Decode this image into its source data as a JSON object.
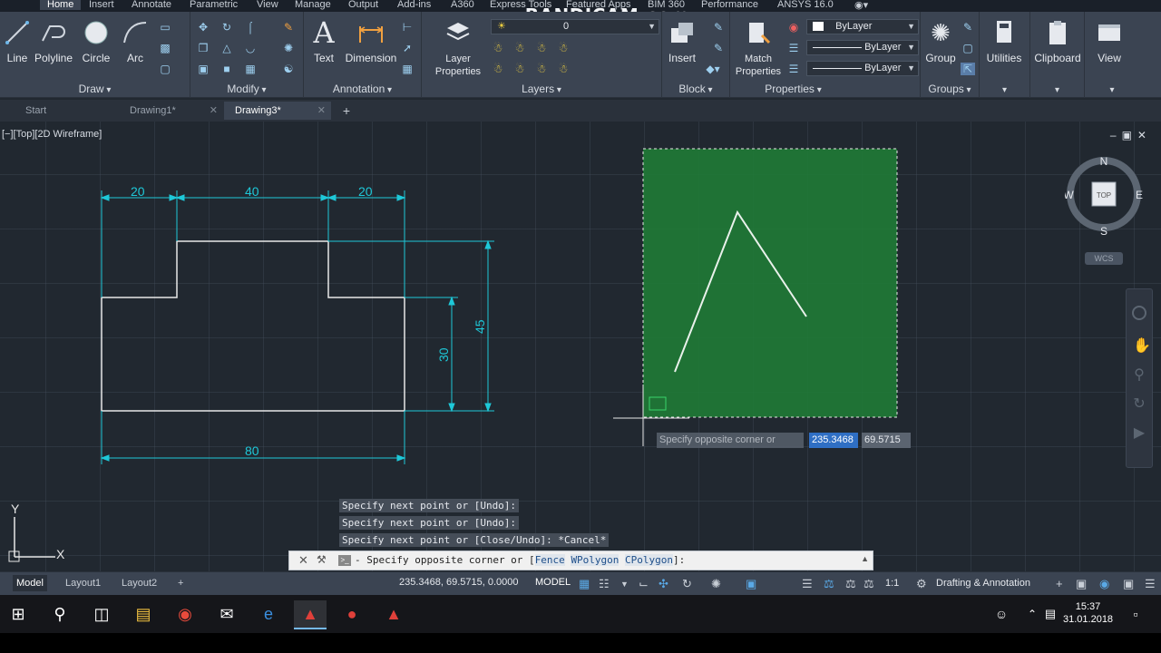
{
  "ribbon_tabs": [
    "Home",
    "Insert",
    "Annotate",
    "Parametric",
    "View",
    "Manage",
    "Output",
    "Add-ins",
    "A360",
    "Express Tools",
    "Featured Apps",
    "BIM 360",
    "Performance",
    "ANSYS 16.0"
  ],
  "watermark": "www.BANDICAM.com",
  "draw_panel": {
    "title": "Draw",
    "tools": [
      "Line",
      "Polyline",
      "Circle",
      "Arc"
    ]
  },
  "modify_panel": {
    "title": "Modify"
  },
  "annotation_panel": {
    "title": "Annotation",
    "text": "Text",
    "dimension": "Dimension"
  },
  "layers_panel": {
    "title": "Layers",
    "layer_properties": "Layer Properties",
    "current_layer": "0"
  },
  "block_panel": {
    "title": "Block",
    "insert": "Insert"
  },
  "properties_panel": {
    "title": "Properties",
    "match": "Match Properties",
    "color": "ByLayer",
    "linetype": "ByLayer",
    "lineweight": "ByLayer"
  },
  "groups_panel": {
    "title": "Groups",
    "group": "Group"
  },
  "utilities": "Utilities",
  "clipboard": "Clipboard",
  "view": "View",
  "file_tabs": [
    {
      "label": "Start"
    },
    {
      "label": "Drawing1*"
    },
    {
      "label": "Drawing3*"
    }
  ],
  "viewport_label": "[−][Top][2D Wireframe]",
  "viewcube": {
    "n": "N",
    "s": "S",
    "e": "E",
    "w": "W",
    "face": "TOP",
    "wcs": "WCS"
  },
  "dimensions": {
    "d1": "20",
    "d2": "40",
    "d3": "20",
    "d4": "45",
    "d5": "30",
    "d6": "80"
  },
  "tooltip": {
    "prompt": "Specify opposite corner or",
    "x": "235.3468",
    "y": "69.5715"
  },
  "history": [
    "Specify next point or [Undo]:",
    "Specify next point or [Undo]:",
    "Specify next point or [Close/Undo]: *Cancel*"
  ],
  "command_line": {
    "prefix": "- Specify opposite corner or [",
    "opt1": "Fence",
    "opt2": "WPolygon",
    "opt3": "CPolygon",
    "suffix": "]:"
  },
  "ucs": {
    "x": "X",
    "y": "Y"
  },
  "layout_tabs": [
    "Model",
    "Layout1",
    "Layout2"
  ],
  "status": {
    "coords": "235.3468, 69.5715, 0.0000",
    "model": "MODEL",
    "scale": "1:1",
    "workspace": "Drafting & Annotation"
  },
  "clock": {
    "time": "15:37",
    "date": "31.01.2018"
  },
  "colors": {
    "canvas": "#212830",
    "ribbon": "#3b4452",
    "dimension": "#1ec8d8",
    "selection": "#1f7a36",
    "geometry": "#e8e8e8"
  }
}
